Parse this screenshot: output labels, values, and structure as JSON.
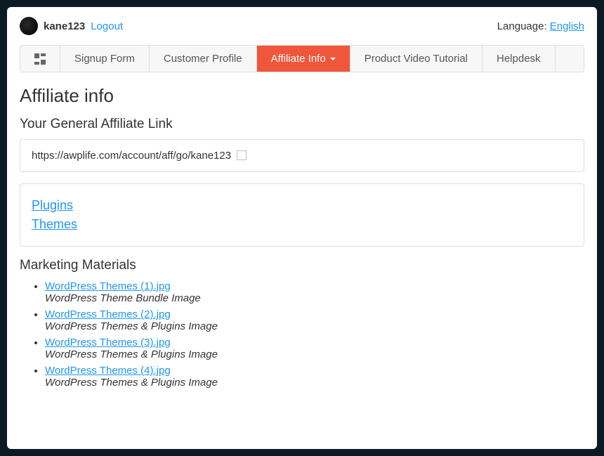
{
  "header": {
    "username": "kane123",
    "logout_label": "Logout",
    "language_label": "Language:",
    "language_value": "English"
  },
  "tabs": {
    "signup": "Signup Form",
    "customer": "Customer Profile",
    "affiliate": "Affiliate Info",
    "tutorial": "Product Video Tutorial",
    "helpdesk": "Helpdesk"
  },
  "page": {
    "title": "Affiliate info",
    "general_link_heading": "Your General Affiliate Link",
    "affiliate_url": "https://awplife.com/account/aff/go/kane123",
    "link_sections": {
      "plugins": "Plugins",
      "themes": "Themes"
    },
    "materials_heading": "Marketing Materials",
    "materials": [
      {
        "name": "WordPress Themes (1).jpg",
        "desc": "WordPress Theme Bundle Image"
      },
      {
        "name": "WordPress Themes (2).jpg",
        "desc": "WordPress Themes & Plugins Image"
      },
      {
        "name": "WordPress Themes (3).jpg",
        "desc": "WordPress Themes & Plugins Image"
      },
      {
        "name": "WordPress Themes (4).jpg",
        "desc": "WordPress Themes & Plugins Image"
      }
    ]
  }
}
